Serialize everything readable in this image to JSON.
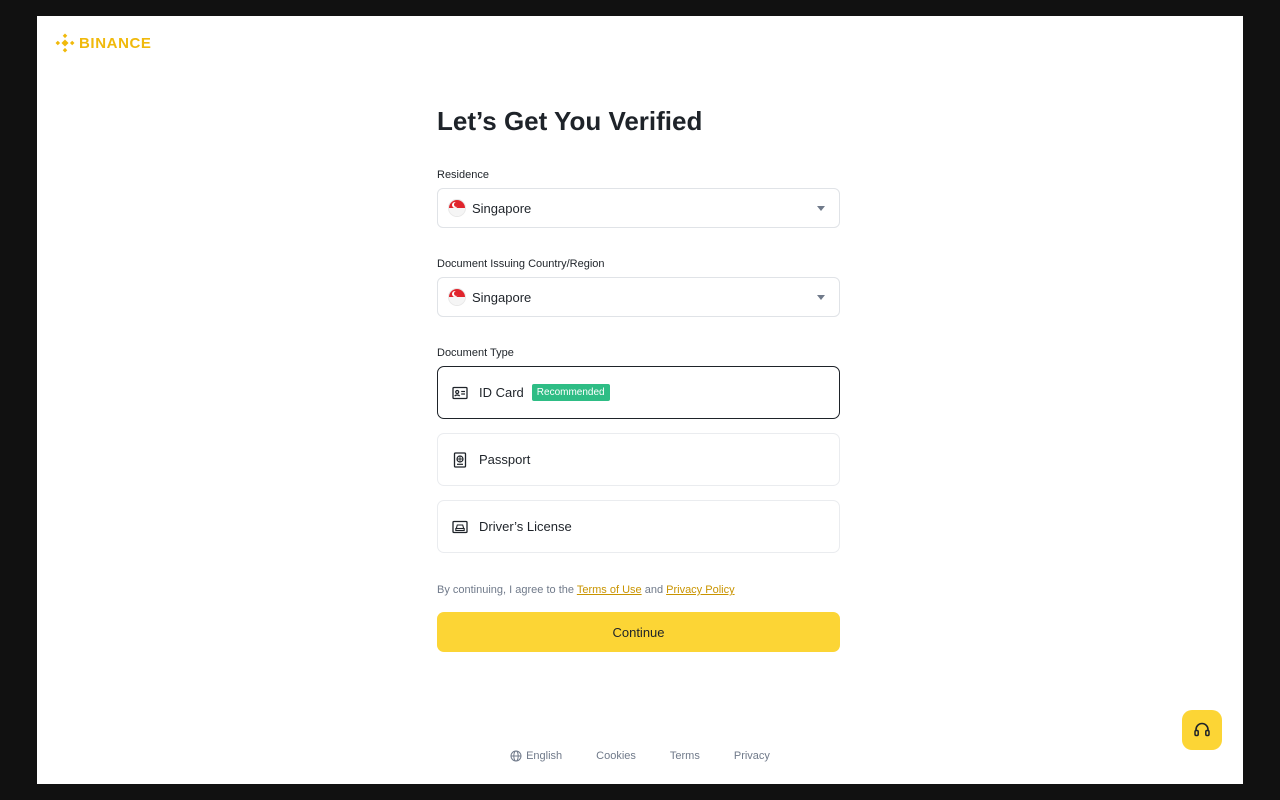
{
  "brand": {
    "name": "BINANCE",
    "color": "#f0b90b"
  },
  "form": {
    "title": "Let’s Get You Verified",
    "residence": {
      "label": "Residence",
      "value": "Singapore",
      "flag": "singapore-flag"
    },
    "issuing_country": {
      "label": "Document Issuing Country/Region",
      "value": "Singapore",
      "flag": "singapore-flag"
    },
    "document_type": {
      "label": "Document Type",
      "options": [
        {
          "label": "ID Card",
          "icon": "id-card-icon",
          "badge": "Recommended",
          "selected": true
        },
        {
          "label": "Passport",
          "icon": "passport-icon",
          "selected": false
        },
        {
          "label": "Driver’s License",
          "icon": "drivers-license-icon",
          "selected": false
        }
      ]
    },
    "terms": {
      "prefix": "By continuing, I agree to the",
      "terms_link": "Terms of Use",
      "conjunction": "and",
      "privacy_link": "Privacy Policy"
    },
    "continue_label": "Continue"
  },
  "footer": {
    "language": "English",
    "cookies": "Cookies",
    "terms": "Terms",
    "privacy": "Privacy"
  },
  "colors": {
    "accent": "#fcd535",
    "badge": "#2ebd85",
    "link": "#c99400",
    "background": "#111111"
  },
  "support": {
    "icon": "headset-icon"
  }
}
